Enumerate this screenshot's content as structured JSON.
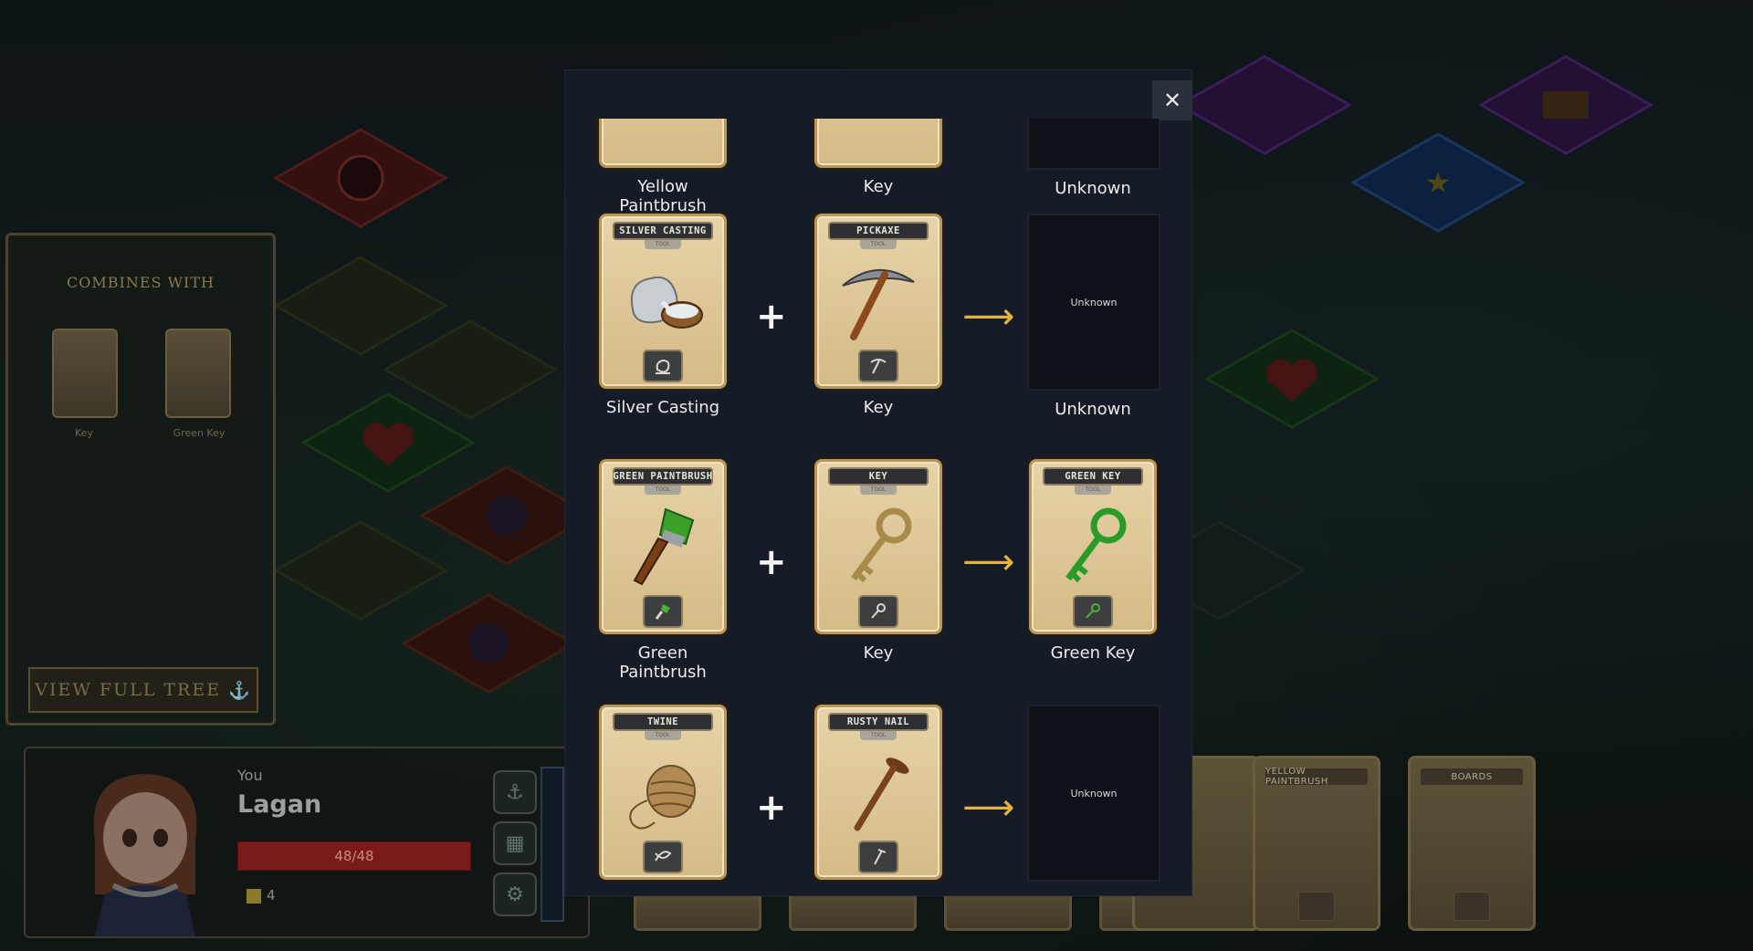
{
  "background": {
    "combines_panel": {
      "title": "COMBINES WITH",
      "from_card": "Key",
      "to_card": "Green Key",
      "view_tree_button": "VIEW FULL TREE"
    },
    "player": {
      "label": "You",
      "name": "Lagan",
      "hp": "48/48",
      "gold": "4"
    },
    "hand_cards": [
      {
        "title": "YELLOW PAINTBRUSH"
      },
      {
        "title": "BOARDS"
      }
    ]
  },
  "modal": {
    "close_label": "✕",
    "plus_symbol": "+",
    "arrow_symbol": "⟶",
    "type_label": "TOOL",
    "recipes": [
      {
        "a": {
          "title": "",
          "label": "Yellow Paintbrush"
        },
        "b": {
          "title": "",
          "label": "Key"
        },
        "result": {
          "known": false,
          "card_text": "",
          "label": "Unknown"
        }
      },
      {
        "a": {
          "title": "SILVER CASTING",
          "label": "Silver Casting",
          "icon": "silver-casting-icon"
        },
        "b": {
          "title": "PICKAXE",
          "label": "Key",
          "icon": "pickaxe-icon"
        },
        "result": {
          "known": false,
          "card_text": "Unknown",
          "label": "Unknown"
        }
      },
      {
        "a": {
          "title": "GREEN PAINTBRUSH",
          "label": "Green Paintbrush",
          "icon": "green-paintbrush-icon"
        },
        "b": {
          "title": "KEY",
          "label": "Key",
          "icon": "key-icon"
        },
        "result": {
          "known": true,
          "title": "GREEN KEY",
          "label": "Green Key",
          "icon": "green-key-icon"
        }
      },
      {
        "a": {
          "title": "TWINE",
          "label": "",
          "icon": "twine-icon"
        },
        "b": {
          "title": "RUSTY NAIL",
          "label": "",
          "icon": "rusty-nail-icon"
        },
        "result": {
          "known": false,
          "card_text": "Unknown",
          "label": ""
        }
      }
    ]
  },
  "colors": {
    "modal_bg": "#151b27",
    "arrow": "#e3b341",
    "card_parchment": "#e7d3a8",
    "hp_bar": "#7a1a1a"
  }
}
